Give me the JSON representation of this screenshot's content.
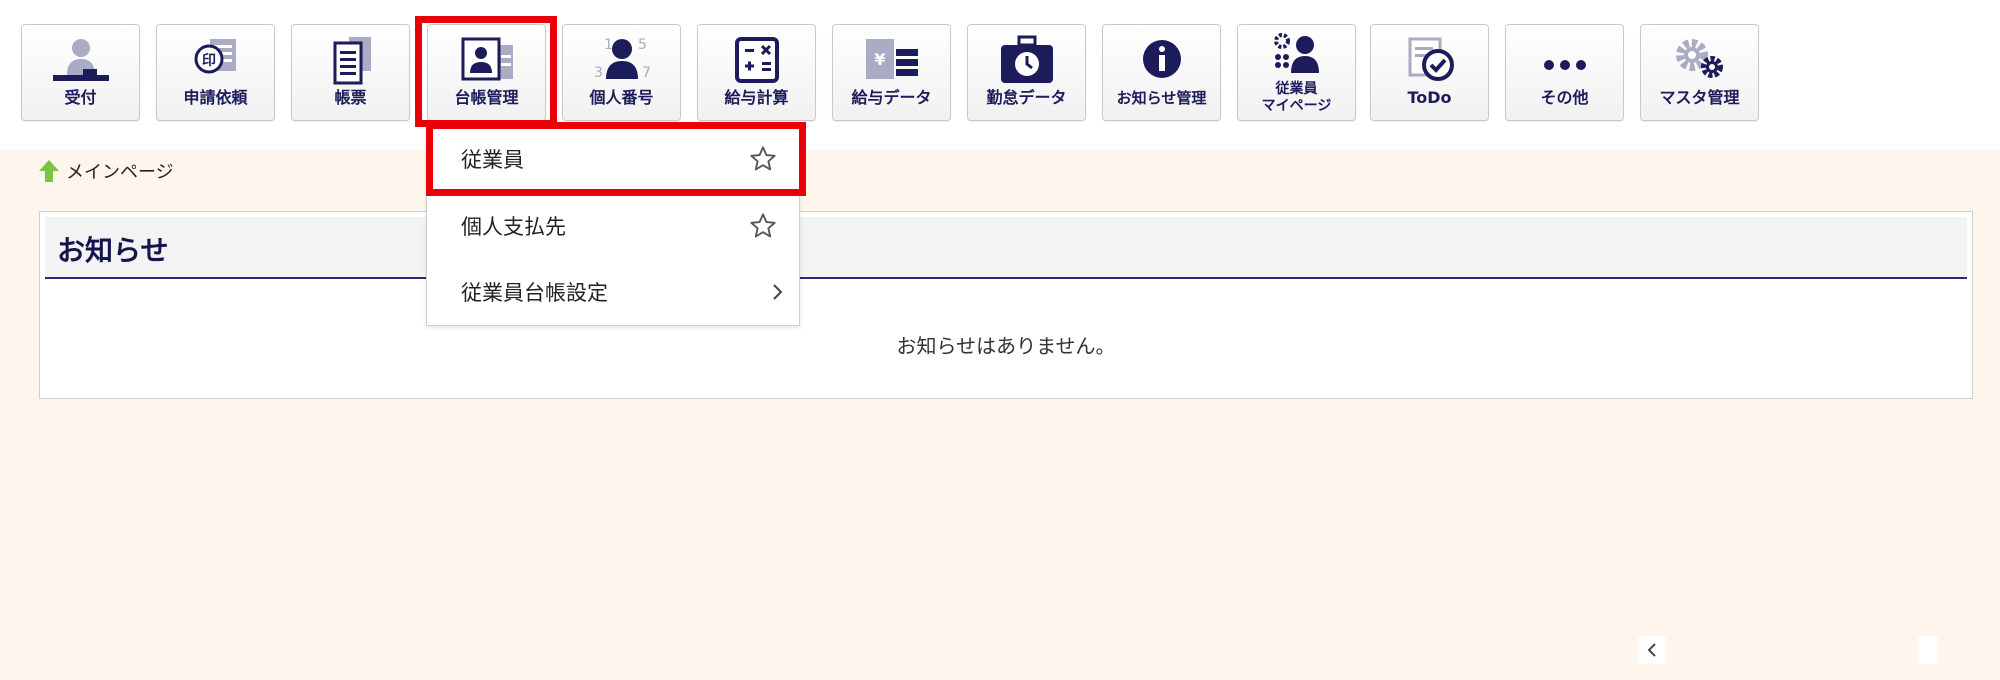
{
  "toolbar": {
    "items": [
      {
        "id": "reception",
        "label": "受付",
        "icon": "reception-icon"
      },
      {
        "id": "request",
        "label": "申請依頼",
        "icon": "seal-request-icon"
      },
      {
        "id": "forms",
        "label": "帳票",
        "icon": "forms-icon"
      },
      {
        "id": "ledger",
        "label": "台帳管理",
        "icon": "ledger-icon"
      },
      {
        "id": "mynumber",
        "label": "個人番号",
        "icon": "mynumber-icon"
      },
      {
        "id": "payroll",
        "label": "給与計算",
        "icon": "calculator-icon"
      },
      {
        "id": "paydata",
        "label": "給与データ",
        "icon": "pay-data-icon"
      },
      {
        "id": "attendance",
        "label": "勤怠データ",
        "icon": "attendance-icon"
      },
      {
        "id": "notices",
        "label": "お知らせ管理",
        "icon": "info-icon"
      },
      {
        "id": "mypage",
        "label_line1": "従業員",
        "label_line2": "マイページ",
        "icon": "employee-mypage-icon"
      },
      {
        "id": "todo",
        "label": "ToDo",
        "icon": "todo-icon"
      },
      {
        "id": "others",
        "label": "その他",
        "icon": "more-icon"
      },
      {
        "id": "master",
        "label": "マスタ管理",
        "icon": "gear-icon"
      }
    ]
  },
  "breadcrumb": {
    "home_label": "メインページ"
  },
  "notice": {
    "title": "お知らせ",
    "empty_message": "お知らせはありません。"
  },
  "dropdown": {
    "items": [
      {
        "label": "従業員",
        "accessory": "star-icon"
      },
      {
        "label": "個人支払先",
        "accessory": "star-icon"
      },
      {
        "label": "従業員台帳設定",
        "accessory": "chevron-right-icon"
      }
    ]
  },
  "pager": {
    "prev_symbol": "‹"
  },
  "colors": {
    "accent_navy": "#1c1c5a",
    "highlight_red": "#ec0008",
    "background_cream": "#fef6ec",
    "home_green": "#7cc243"
  }
}
